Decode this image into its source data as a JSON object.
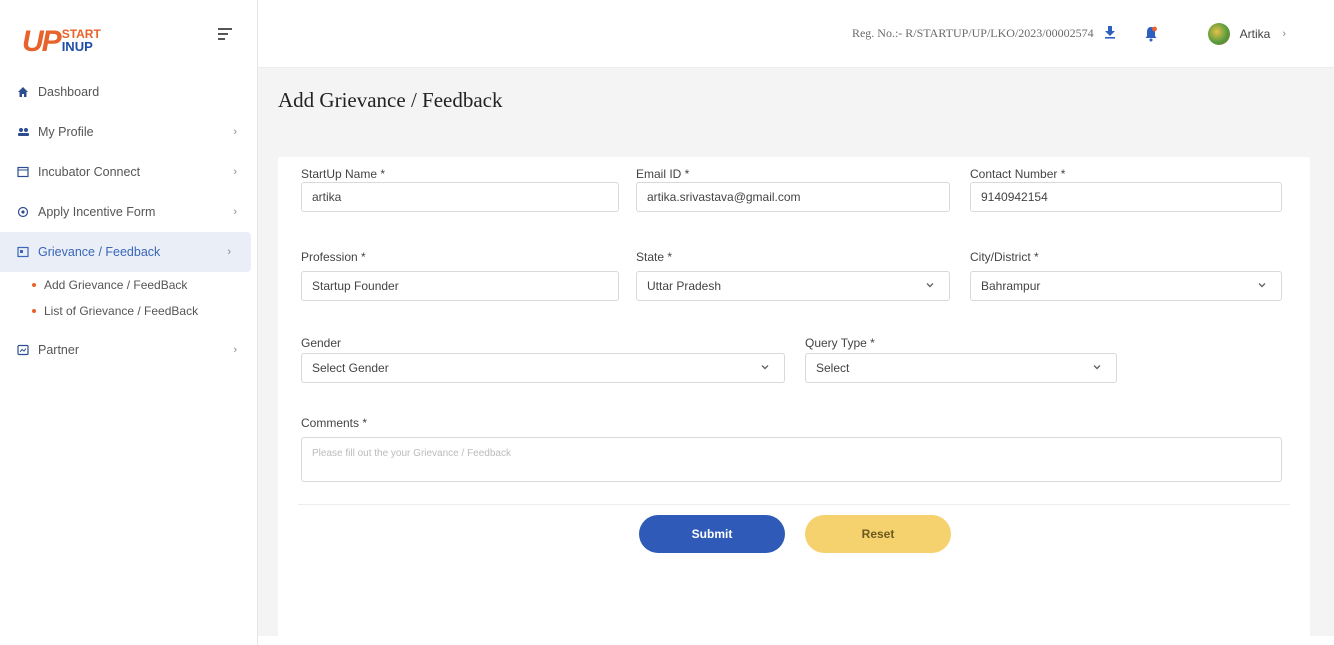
{
  "logo": {
    "up": "UP",
    "start": "START",
    "inup": "INUP"
  },
  "header": {
    "reg_no": "Reg. No.:- R/STARTUP/UP/LKO/2023/00002574",
    "user_name": "Artika",
    "user_chevron": "›"
  },
  "sidebar": {
    "items": [
      {
        "label": "Dashboard",
        "icon": "home-icon",
        "chevron": ""
      },
      {
        "label": "My Profile",
        "icon": "users-icon",
        "chevron": "›"
      },
      {
        "label": "Incubator Connect",
        "icon": "window-icon",
        "chevron": "›"
      },
      {
        "label": "Apply Incentive Form",
        "icon": "coins-icon",
        "chevron": "›"
      },
      {
        "label": "Grievance / Feedback",
        "icon": "feedback-icon",
        "chevron": "›"
      },
      {
        "label": "Partner",
        "icon": "partner-icon",
        "chevron": "›"
      }
    ],
    "sub_items": [
      {
        "label": "Add Grievance / FeedBack"
      },
      {
        "label": "List of Grievance / FeedBack"
      }
    ]
  },
  "main": {
    "title": "Add Grievance / Feedback",
    "form": {
      "startup_name": {
        "label": "StartUp Name *",
        "value": "artika"
      },
      "email": {
        "label": "Email ID *",
        "value": "artika.srivastava@gmail.com"
      },
      "contact": {
        "label": "Contact Number *",
        "value": "9140942154"
      },
      "profession": {
        "label": "Profession *",
        "value": "Startup Founder"
      },
      "state": {
        "label": "State *",
        "value": "Uttar Pradesh"
      },
      "city": {
        "label": "City/District *",
        "value": "Bahrampur"
      },
      "gender": {
        "label": "Gender",
        "value": "Select Gender"
      },
      "query_type": {
        "label": "Query Type *",
        "value": "Select"
      },
      "comments": {
        "label": "Comments *",
        "placeholder": "Please fill out the your Grievance / Feedback"
      },
      "submit_label": "Submit",
      "reset_label": "Reset"
    }
  },
  "colors": {
    "primary": "#2f5ab8",
    "reset": "#f6d26e",
    "accent": "#e8622c",
    "background": "#f4f4f4"
  }
}
